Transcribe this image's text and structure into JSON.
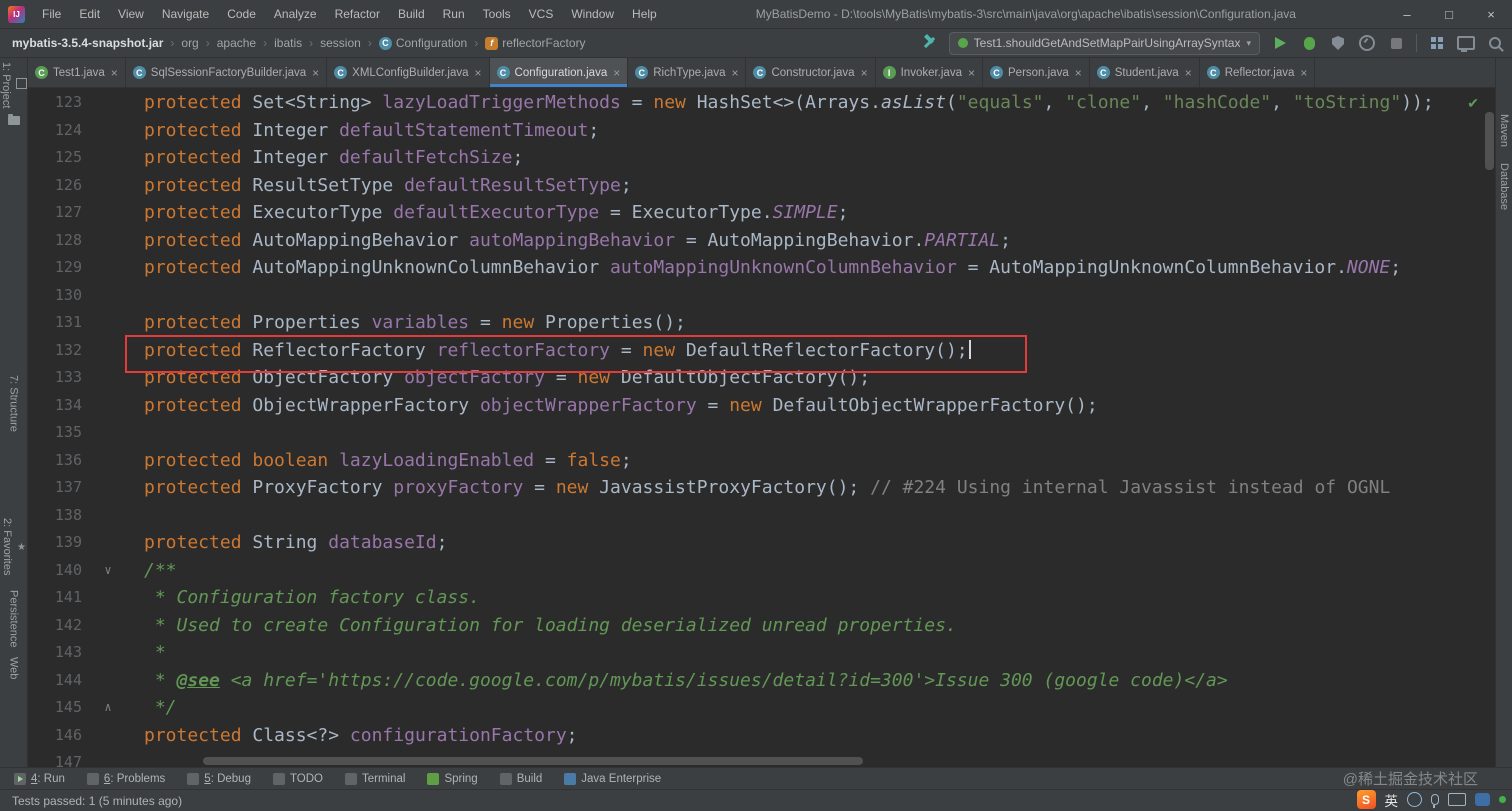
{
  "accents": {
    "tab_underline": "#4083c9",
    "highlight_box": "#e13c3c",
    "run_green": "#5caf5f",
    "check_green": "#5c9e58"
  },
  "title_bar": {
    "app_icon": "IJ",
    "menus": [
      "File",
      "Edit",
      "View",
      "Navigate",
      "Code",
      "Analyze",
      "Refactor",
      "Build",
      "Run",
      "Tools",
      "VCS",
      "Window",
      "Help"
    ],
    "title": "MyBatisDemo - D:\\tools\\MyBatis\\mybatis-3\\src\\main\\java\\org\\apache\\ibatis\\session\\Configuration.java",
    "window_controls": {
      "minimize": "–",
      "maximize": "□",
      "close": "×"
    }
  },
  "breadcrumbs": {
    "items": [
      {
        "label": "mybatis-3.5.4-snapshot.jar",
        "bold": true
      },
      {
        "label": "org"
      },
      {
        "label": "apache"
      },
      {
        "label": "ibatis"
      },
      {
        "label": "session"
      },
      {
        "label": "Configuration",
        "icon": "class",
        "icon_letter": "C"
      },
      {
        "label": "reflectorFactory",
        "icon": "field",
        "icon_letter": "f"
      }
    ],
    "separator": "›"
  },
  "run_widget": {
    "config_name": "Test1.shouldGetAndSetMapPairUsingArraySyntax"
  },
  "tabs": {
    "active": "Configuration.java",
    "close_glyph": "×",
    "items": [
      {
        "label": "Test1.java",
        "icon": "C",
        "icon_color": "#5a9e55"
      },
      {
        "label": "SqlSessionFactoryBuilder.java",
        "icon": "C",
        "icon_color": "#4f8da6"
      },
      {
        "label": "XMLConfigBuilder.java",
        "icon": "C",
        "icon_color": "#4f8da6"
      },
      {
        "label": "Configuration.java",
        "icon": "C",
        "icon_color": "#4f8da6"
      },
      {
        "label": "RichType.java",
        "icon": "C",
        "icon_color": "#4f8da6"
      },
      {
        "label": "Constructor.java",
        "icon": "C",
        "icon_color": "#4f8da6"
      },
      {
        "label": "Invoker.java",
        "icon": "I",
        "icon_color": "#5a9e55"
      },
      {
        "label": "Person.java",
        "icon": "C",
        "icon_color": "#4f8da6"
      },
      {
        "label": "Student.java",
        "icon": "C",
        "icon_color": "#4f8da6"
      },
      {
        "label": "Reflector.java",
        "icon": "C",
        "icon_color": "#4f8da6"
      }
    ]
  },
  "editor": {
    "colors": {
      "background": "#2b2b2b",
      "gutter_text": "#606366",
      "keyword": "#cc7832",
      "plain": "#a9b7c6",
      "field": "#9876aa",
      "string": "#6a8759",
      "constant": "#9876aa",
      "doc_comment": "#629755",
      "line_comment": "#808080"
    },
    "lines": [
      {
        "no": 123,
        "seg": [
          [
            "k",
            "protected "
          ],
          [
            "p",
            "Set<String> "
          ],
          [
            "f",
            "lazyLoadTriggerMethods"
          ],
          [
            "p",
            " = "
          ],
          [
            "k",
            "new "
          ],
          [
            "p",
            "HashSet<>(Arrays."
          ],
          [
            "m",
            "asList"
          ],
          [
            "p",
            "("
          ],
          [
            "s",
            "\"equals\""
          ],
          [
            "p",
            ", "
          ],
          [
            "s",
            "\"clone\""
          ],
          [
            "p",
            ", "
          ],
          [
            "s",
            "\"hashCode\""
          ],
          [
            "p",
            ", "
          ],
          [
            "s",
            "\"toString\""
          ],
          [
            "p",
            "));"
          ]
        ]
      },
      {
        "no": 124,
        "seg": [
          [
            "k",
            "protected "
          ],
          [
            "p",
            "Integer "
          ],
          [
            "f",
            "defaultStatementTimeout"
          ],
          [
            "p",
            ";"
          ]
        ]
      },
      {
        "no": 125,
        "seg": [
          [
            "k",
            "protected "
          ],
          [
            "p",
            "Integer "
          ],
          [
            "f",
            "defaultFetchSize"
          ],
          [
            "p",
            ";"
          ]
        ]
      },
      {
        "no": 126,
        "seg": [
          [
            "k",
            "protected "
          ],
          [
            "p",
            "ResultSetType "
          ],
          [
            "f",
            "defaultResultSetType"
          ],
          [
            "p",
            ";"
          ]
        ]
      },
      {
        "no": 127,
        "seg": [
          [
            "k",
            "protected "
          ],
          [
            "p",
            "ExecutorType "
          ],
          [
            "f",
            "defaultExecutorType"
          ],
          [
            "p",
            " = ExecutorType."
          ],
          [
            "c",
            "SIMPLE"
          ],
          [
            "p",
            ";"
          ]
        ]
      },
      {
        "no": 128,
        "seg": [
          [
            "k",
            "protected "
          ],
          [
            "p",
            "AutoMappingBehavior "
          ],
          [
            "f",
            "autoMappingBehavior"
          ],
          [
            "p",
            " = AutoMappingBehavior."
          ],
          [
            "c",
            "PARTIAL"
          ],
          [
            "p",
            ";"
          ]
        ]
      },
      {
        "no": 129,
        "seg": [
          [
            "k",
            "protected "
          ],
          [
            "p",
            "AutoMappingUnknownColumnBehavior "
          ],
          [
            "f",
            "autoMappingUnknownColumnBehavior"
          ],
          [
            "p",
            " = AutoMappingUnknownColumnBehavior."
          ],
          [
            "c",
            "NONE"
          ],
          [
            "p",
            ";"
          ]
        ]
      },
      {
        "no": 130,
        "seg": []
      },
      {
        "no": 131,
        "seg": [
          [
            "k",
            "protected "
          ],
          [
            "p",
            "Properties "
          ],
          [
            "f",
            "variables"
          ],
          [
            "p",
            " = "
          ],
          [
            "k",
            "new "
          ],
          [
            "p",
            "Properties();"
          ]
        ]
      },
      {
        "no": 132,
        "seg": [
          [
            "k",
            "protected "
          ],
          [
            "p",
            "ReflectorFactory "
          ],
          [
            "f",
            "reflectorFactory"
          ],
          [
            "p",
            " = "
          ],
          [
            "k",
            "new "
          ],
          [
            "p",
            "DefaultReflectorFactory();"
          ],
          [
            "caret",
            ""
          ]
        ]
      },
      {
        "no": 133,
        "seg": [
          [
            "k",
            "protected "
          ],
          [
            "p",
            "ObjectFactory "
          ],
          [
            "f",
            "objectFactory"
          ],
          [
            "p",
            " = "
          ],
          [
            "k",
            "new "
          ],
          [
            "p",
            "DefaultObjectFactory();"
          ]
        ]
      },
      {
        "no": 134,
        "seg": [
          [
            "k",
            "protected "
          ],
          [
            "p",
            "ObjectWrapperFactory "
          ],
          [
            "f",
            "objectWrapperFactory"
          ],
          [
            "p",
            " = "
          ],
          [
            "k",
            "new "
          ],
          [
            "p",
            "DefaultObjectWrapperFactory();"
          ]
        ]
      },
      {
        "no": 135,
        "seg": []
      },
      {
        "no": 136,
        "seg": [
          [
            "k",
            "protected boolean "
          ],
          [
            "f",
            "lazyLoadingEnabled"
          ],
          [
            "p",
            " = "
          ],
          [
            "k",
            "false"
          ],
          [
            "p",
            ";"
          ]
        ]
      },
      {
        "no": 137,
        "seg": [
          [
            "k",
            "protected "
          ],
          [
            "p",
            "ProxyFactory "
          ],
          [
            "f",
            "proxyFactory"
          ],
          [
            "p",
            " = "
          ],
          [
            "k",
            "new "
          ],
          [
            "p",
            "JavassistProxyFactory(); "
          ],
          [
            "lc",
            "// #224 Using internal Javassist instead of OGNL"
          ]
        ]
      },
      {
        "no": 138,
        "seg": []
      },
      {
        "no": 139,
        "seg": [
          [
            "k",
            "protected "
          ],
          [
            "p",
            "String "
          ],
          [
            "f",
            "databaseId"
          ],
          [
            "p",
            ";"
          ]
        ]
      },
      {
        "no": 140,
        "gicon": "∨",
        "seg": [
          [
            "dc",
            "/**"
          ]
        ]
      },
      {
        "no": 141,
        "seg": [
          [
            "dc",
            " * Configuration factory class."
          ]
        ]
      },
      {
        "no": 142,
        "seg": [
          [
            "dc",
            " * Used to create Configuration for loading deserialized unread properties."
          ]
        ]
      },
      {
        "no": 143,
        "seg": [
          [
            "dc",
            " *"
          ]
        ]
      },
      {
        "no": 144,
        "seg": [
          [
            "dc",
            " * "
          ],
          [
            "dt",
            "@see"
          ],
          [
            "dc",
            " <a href='https://code.google.com/p/mybatis/issues/detail?id=300'>Issue 300 (google code)</a>"
          ]
        ]
      },
      {
        "no": 145,
        "gicon": "∧",
        "seg": [
          [
            "dc",
            " */"
          ]
        ]
      },
      {
        "no": 146,
        "seg": [
          [
            "k",
            "protected "
          ],
          [
            "p",
            "Class<?> "
          ],
          [
            "f",
            "configurationFactory"
          ],
          [
            "p",
            ";"
          ]
        ]
      },
      {
        "no": 147,
        "seg": []
      }
    ]
  },
  "left_strip": {
    "items": [
      {
        "label": "1: Project",
        "icon": "project"
      },
      {
        "icon": "folder"
      },
      {
        "label": "7: Structure"
      },
      {
        "label": "2: Favorites",
        "icon": "star",
        "star": "★"
      },
      {
        "label": "Persistence"
      },
      {
        "label": "Web"
      }
    ]
  },
  "right_strip": {
    "items": [
      {
        "label": "Maven"
      },
      {
        "label": "Database"
      }
    ]
  },
  "tool_window_bar": {
    "items": [
      {
        "label": "4: Run",
        "icon": "run",
        "u": true
      },
      {
        "label": "6: Problems",
        "icon": "problems",
        "u": true
      },
      {
        "label": "5: Debug",
        "icon": "debug",
        "u": true
      },
      {
        "label": "TODO",
        "icon": "todo"
      },
      {
        "label": "Terminal",
        "icon": "terminal"
      },
      {
        "label": "Spring",
        "icon": "spring"
      },
      {
        "label": "Build",
        "icon": "build"
      },
      {
        "label": "Java Enterprise",
        "icon": "jee"
      }
    ]
  },
  "status_bar": {
    "message": "Tests passed: 1 (5 minutes ago)"
  },
  "overlay": {
    "watermark": "@稀土掘金技术社区",
    "ime_engine_letter": "S",
    "ime_lang": "英"
  }
}
